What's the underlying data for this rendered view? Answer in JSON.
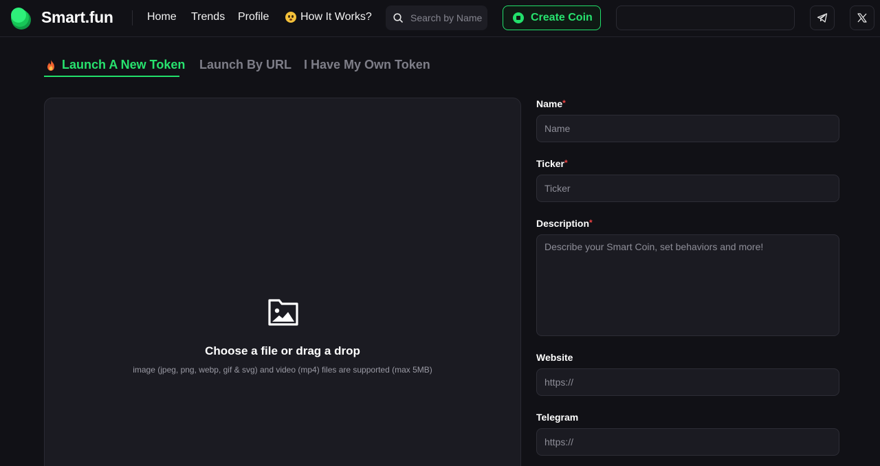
{
  "header": {
    "brand": "Smart.fun",
    "nav": {
      "home": "Home",
      "trends": "Trends",
      "profile": "Profile",
      "how_it_works": "How It Works?"
    },
    "search": {
      "placeholder": "Search by Name"
    },
    "create_coin": "Create Coin",
    "wallet_value": ""
  },
  "tabs": {
    "launch_new": "Launch A New Token",
    "launch_url": "Launch By URL",
    "own_token": "I Have My Own Token"
  },
  "upload": {
    "title": "Choose a file or drag a drop",
    "hint": "image (jpeg, png, webp, gif & svg) and video (mp4) files are supported (max 5MB)"
  },
  "form": {
    "name": {
      "label": "Name",
      "required_mark": "*",
      "placeholder": "Name",
      "value": ""
    },
    "ticker": {
      "label": "Ticker",
      "required_mark": "*",
      "placeholder": "Ticker",
      "value": ""
    },
    "description": {
      "label": "Description",
      "required_mark": "*",
      "placeholder": "Describe your Smart Coin, set behaviors and more!",
      "value": ""
    },
    "website": {
      "label": "Website",
      "placeholder": "https://",
      "value": ""
    },
    "telegram": {
      "label": "Telegram",
      "placeholder": "https://",
      "value": ""
    }
  },
  "colors": {
    "accent": "#22e06b",
    "background": "#111116",
    "panel": "#1b1b22",
    "required": "#ef4444",
    "inactive_tab": "#7e7e88"
  },
  "icons": {
    "logo": "stacked-coins-logo",
    "search": "search-icon",
    "create": "coin-plus-icon",
    "telegram": "telegram-icon",
    "x": "x-icon",
    "tab_active": "fire-icon",
    "upload": "image-folder-icon",
    "how_it_works": "flushed-face-emoji"
  }
}
